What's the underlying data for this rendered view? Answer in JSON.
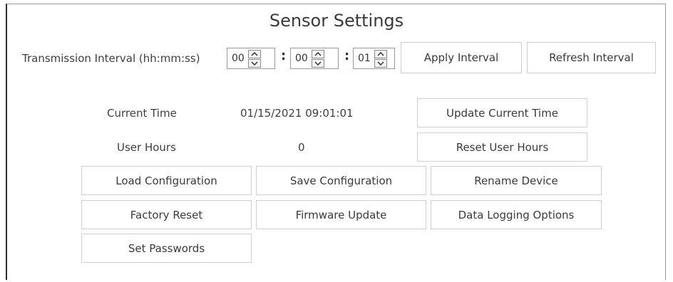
{
  "title": "Sensor Settings",
  "interval": {
    "label": "Transmission Interval (hh:mm:ss)",
    "hours": "00",
    "minutes": "00",
    "seconds": "01",
    "separator": ":",
    "apply_label": "Apply Interval",
    "refresh_label": "Refresh Interval"
  },
  "current_time": {
    "label": "Current Time",
    "value": "01/15/2021 09:01:01",
    "update_label": "Update Current Time"
  },
  "user_hours": {
    "label": "User Hours",
    "value": "0",
    "reset_label": "Reset User Hours"
  },
  "actions": {
    "load_config": "Load Configuration",
    "save_config": "Save Configuration",
    "rename_device": "Rename Device",
    "factory_reset": "Factory Reset",
    "firmware_update": "Firmware Update",
    "data_logging": "Data Logging Options",
    "set_passwords": "Set Passwords"
  }
}
